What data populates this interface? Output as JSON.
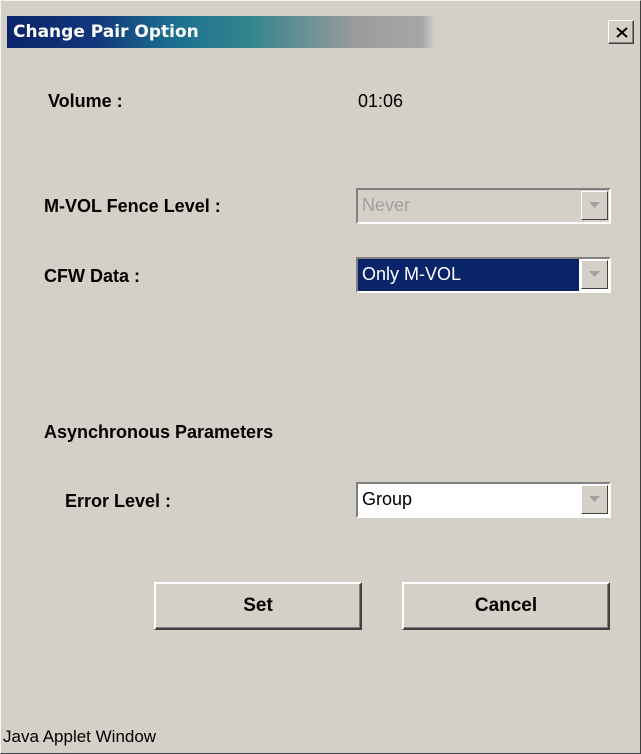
{
  "window": {
    "title": "Change Pair Option",
    "close_icon": "close-icon",
    "footer": "Java Applet Window"
  },
  "form": {
    "volume_label": "Volume :",
    "volume_value": "01:06",
    "fence_level_label": "M-VOL Fence Level :",
    "fence_level_value": "Never",
    "fence_level_enabled": false,
    "cfw_data_label": "CFW Data :",
    "cfw_data_value": "Only M-VOL",
    "async_heading": "Asynchronous Parameters",
    "error_level_label": "Error Level :",
    "error_level_value": "Group"
  },
  "buttons": {
    "set_label": "Set",
    "cancel_label": "Cancel"
  },
  "colors": {
    "window_bg": "#d4d0c8",
    "title_active": "#0a246a",
    "selection": "#0a246a",
    "disabled_text": "#a0a0a0"
  }
}
